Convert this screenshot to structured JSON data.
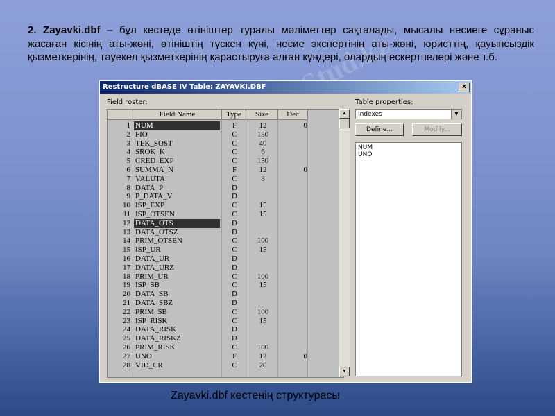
{
  "intro": {
    "title": "2. Zayavki.dbf",
    "text": " – бұл кестеде өтініштер туралы мәліметтер сақталады, мысалы несиеге сұраныс жасаған кісінің аты-жөні, өтініштің түскен күні, несие экспертінің аты-жөні, юристтің, қауыпсыздік қызметкерінің, тәуекел қызметкерінің қарастыруға алған күндері, олардың ескертпелері және  т.б."
  },
  "watermark": "Stud.kz",
  "dialog": {
    "title": "Restructure dBASE IV Table: ZAYAVKI.DBF",
    "close": "x",
    "field_roster_label": "Field roster:",
    "columns": [
      "Field Name",
      "Type",
      "Size",
      "Dec"
    ],
    "table_properties_label": "Table properties:",
    "properties_selected": "Indexes",
    "define_label": "Define...",
    "modify_label": "Modify...",
    "indexes": [
      "NUM",
      "UNO"
    ],
    "selected_rows": [
      1,
      12
    ],
    "fields": [
      {
        "n": "1",
        "name": "NUM",
        "type": "F",
        "size": "12",
        "dec": "0"
      },
      {
        "n": "2",
        "name": "FIO",
        "type": "C",
        "size": "150",
        "dec": ""
      },
      {
        "n": "3",
        "name": "TEK_SOST",
        "type": "C",
        "size": "40",
        "dec": ""
      },
      {
        "n": "4",
        "name": "SROK_K",
        "type": "C",
        "size": "6",
        "dec": ""
      },
      {
        "n": "5",
        "name": "CRED_EXP",
        "type": "C",
        "size": "150",
        "dec": ""
      },
      {
        "n": "6",
        "name": "SUMMA_N",
        "type": "F",
        "size": "12",
        "dec": "0"
      },
      {
        "n": "7",
        "name": "VALUTA",
        "type": "C",
        "size": "8",
        "dec": ""
      },
      {
        "n": "8",
        "name": "DATA_P",
        "type": "D",
        "size": "",
        "dec": ""
      },
      {
        "n": "9",
        "name": "P_DATA_V",
        "type": "D",
        "size": "",
        "dec": ""
      },
      {
        "n": "10",
        "name": "ISP_EXP",
        "type": "C",
        "size": "15",
        "dec": ""
      },
      {
        "n": "11",
        "name": "ISP_OTSEN",
        "type": "C",
        "size": "15",
        "dec": ""
      },
      {
        "n": "12",
        "name": "DATA_OTS",
        "type": "D",
        "size": "",
        "dec": ""
      },
      {
        "n": "13",
        "name": "DATA_OTSZ",
        "type": "D",
        "size": "",
        "dec": ""
      },
      {
        "n": "14",
        "name": "PRIM_OTSEN",
        "type": "C",
        "size": "100",
        "dec": ""
      },
      {
        "n": "15",
        "name": "ISP_UR",
        "type": "C",
        "size": "15",
        "dec": ""
      },
      {
        "n": "16",
        "name": "DATA_UR",
        "type": "D",
        "size": "",
        "dec": ""
      },
      {
        "n": "17",
        "name": "DATA_URZ",
        "type": "D",
        "size": "",
        "dec": ""
      },
      {
        "n": "18",
        "name": "PRIM_UR",
        "type": "C",
        "size": "100",
        "dec": ""
      },
      {
        "n": "19",
        "name": "ISP_SB",
        "type": "C",
        "size": "15",
        "dec": ""
      },
      {
        "n": "20",
        "name": "DATA_SB",
        "type": "D",
        "size": "",
        "dec": ""
      },
      {
        "n": "21",
        "name": "DATA_SBZ",
        "type": "D",
        "size": "",
        "dec": ""
      },
      {
        "n": "22",
        "name": "PRIM_SB",
        "type": "C",
        "size": "100",
        "dec": ""
      },
      {
        "n": "23",
        "name": "ISP_RISK",
        "type": "C",
        "size": "15",
        "dec": ""
      },
      {
        "n": "24",
        "name": "DATA_RISK",
        "type": "D",
        "size": "",
        "dec": ""
      },
      {
        "n": "25",
        "name": "DATA_RISKZ",
        "type": "D",
        "size": "",
        "dec": ""
      },
      {
        "n": "26",
        "name": "PRIM_RISK",
        "type": "C",
        "size": "100",
        "dec": ""
      },
      {
        "n": "27",
        "name": "UNO",
        "type": "F",
        "size": "12",
        "dec": "0"
      },
      {
        "n": "28",
        "name": "VID_CR",
        "type": "C",
        "size": "20",
        "dec": ""
      }
    ]
  },
  "caption": "Zayavki.dbf кестенің структурасы"
}
